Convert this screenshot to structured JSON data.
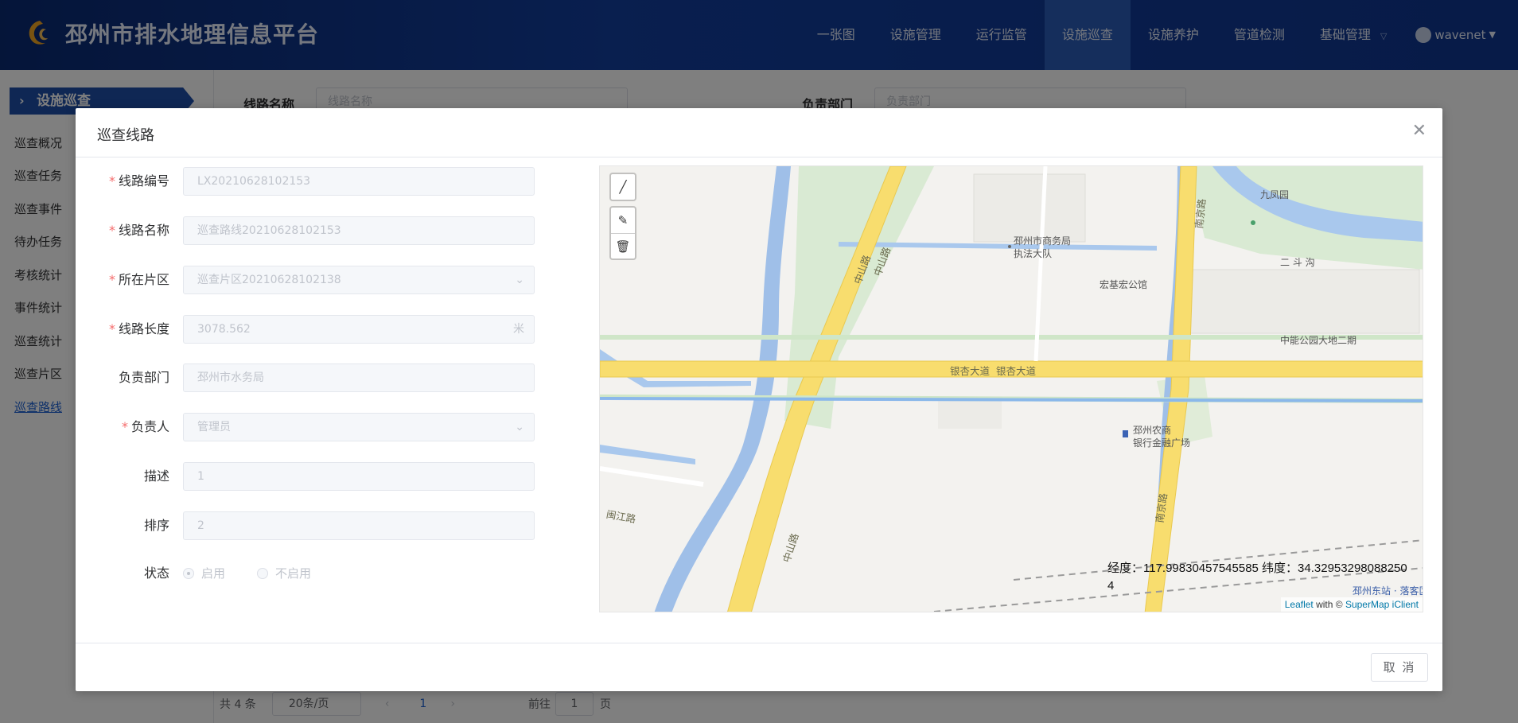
{
  "app": {
    "title": "邳州市排水地理信息平台"
  },
  "nav": {
    "items": [
      "一张图",
      "设施管理",
      "运行监管",
      "设施巡查",
      "设施养护",
      "管道检测",
      "基础管理"
    ],
    "active": "设施巡查",
    "user": "wavenet"
  },
  "sidebar": {
    "header": "设施巡查",
    "items": [
      "巡查概况",
      "巡查任务",
      "巡查事件",
      "待办任务",
      "考核统计",
      "事件统计",
      "巡查统计",
      "巡查片区",
      "巡查路线"
    ],
    "active": "巡查路线"
  },
  "background": {
    "filter_route_label": "线路名称",
    "filter_route_placeholder": "线路名称",
    "filter_dept_label": "负责部门",
    "filter_dept_placeholder": "负责部门",
    "pager": {
      "total": "共 4 条",
      "page_size": "20条/页",
      "current_page": "1",
      "goto_label": "前往",
      "goto_value": "1",
      "goto_unit": "页"
    }
  },
  "dialog": {
    "title": "巡查线路",
    "cancel_label": "取 消",
    "form": {
      "route_code": {
        "label": "线路编号",
        "value": "LX20210628102153"
      },
      "route_name": {
        "label": "线路名称",
        "value": "巡查路线20210628102153"
      },
      "area": {
        "label": "所在片区",
        "value": "巡查片区20210628102138"
      },
      "length": {
        "label": "线路长度",
        "value": "3078.562",
        "unit": "米"
      },
      "dept": {
        "label": "负责部门",
        "value": "邳州市水务局"
      },
      "owner": {
        "label": "负责人",
        "value": "管理员"
      },
      "desc": {
        "label": "描述",
        "value": "1"
      },
      "sort": {
        "label": "排序",
        "value": "2"
      },
      "status": {
        "label": "状态",
        "options": [
          "启用",
          "不启用"
        ],
        "selected": "启用"
      }
    },
    "map": {
      "labels": {
        "commerce": "邳州市商务局",
        "enforcement": "执法大队",
        "hongji": "宏基宏公馆",
        "jiufeng": "九凤园",
        "erdou": "二 斗 沟",
        "zhongneng": "中能公园大地二期",
        "nongshang1": "邳州农商",
        "nongshang2": "银行金融广场",
        "yinxing": "银杏大道",
        "yinxing2": "银杏大道",
        "zhongshan1": "中山路",
        "zhongshan2": "中山路",
        "zhongshan3": "中山路",
        "nanjing1": "南京路",
        "nanjing2": "南京路",
        "minjiang": "闽江路",
        "station": "邳州东站 · 落客区"
      },
      "coord_line1": "经度：117.99830457545585 纬度：34.32953298088250",
      "coord_line2": "4",
      "attribution_leaflet": "Leaflet",
      "attribution_with": " with © ",
      "attribution_supermap": "SuperMap iClient"
    }
  }
}
